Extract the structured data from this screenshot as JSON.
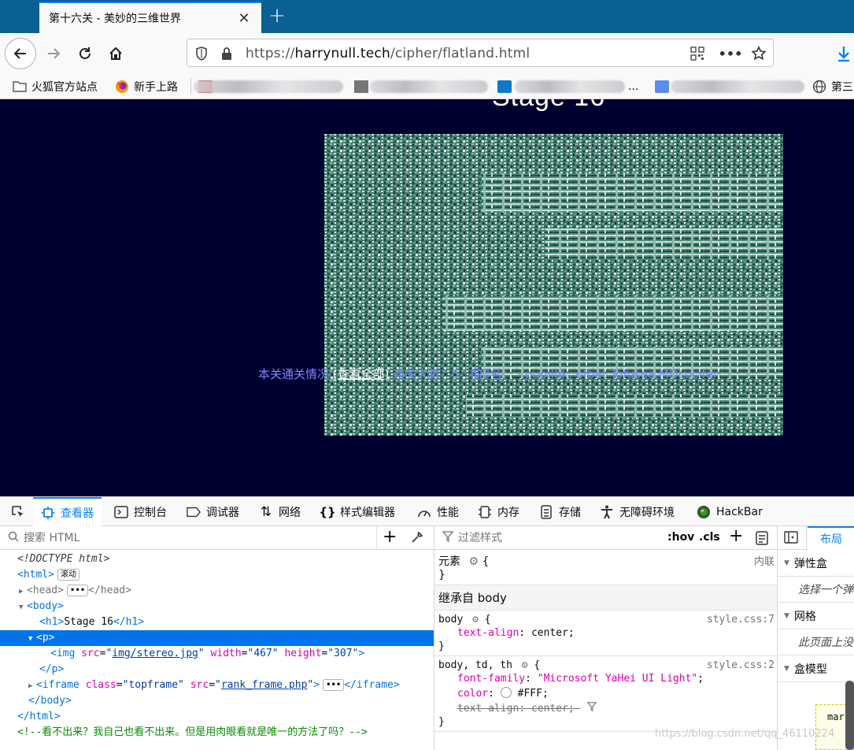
{
  "browser": {
    "tab_title": "第十六关 - 美妙的三维世界",
    "url_scheme": "https://",
    "url_host": "harrynull.tech",
    "url_path": "/cipher/flatland.html"
  },
  "bookmarks": [
    {
      "label": "火狐官方站点",
      "icon": "folder-icon"
    },
    {
      "label": "新手上路",
      "icon": "firefox-icon"
    },
    {
      "label": "...",
      "icon": "none"
    },
    {
      "label": "第三",
      "icon": "globe-icon"
    }
  ],
  "page": {
    "heading": "Stage 16",
    "rank_text_prefix": "本关通关情况 ",
    "rank_link": "(查看全部)",
    "rank_text_suffix": "   通关人数：5   ·   前3名：   ·   pupilbk,   ofbat Tofusea,MDLucifer"
  },
  "devtools": {
    "tabs": [
      {
        "label": "查看器",
        "icon": "inspector-icon",
        "active": true
      },
      {
        "label": "控制台",
        "icon": "console-icon"
      },
      {
        "label": "调试器",
        "icon": "debugger-icon"
      },
      {
        "label": "网络",
        "icon": "network-icon"
      },
      {
        "label": "样式编辑器",
        "icon": "style-editor-icon"
      },
      {
        "label": "性能",
        "icon": "performance-icon"
      },
      {
        "label": "内存",
        "icon": "memory-icon"
      },
      {
        "label": "存储",
        "icon": "storage-icon"
      },
      {
        "label": "无障碍环境",
        "icon": "accessibility-icon"
      },
      {
        "label": "HackBar",
        "icon": "hackbar-icon"
      }
    ],
    "markup": {
      "search_placeholder": "搜索 HTML",
      "doctype": "<!DOCTYPE html>",
      "html_badge": "滚动",
      "h1_text": "Stage 16",
      "img_src": "img/stereo.jpg",
      "img_width": "467",
      "img_height": "307",
      "iframe_class": "topframe",
      "iframe_src": "rank_frame.php",
      "comment": "<!--看不出来？我自己也看不出来。但是用肉眼看就是唯一的方法了吗？-->"
    },
    "rules": {
      "filter_placeholder": "过滤样式",
      "hov": ":hov",
      "cls": ".cls",
      "element_label": "元素",
      "inline_label": "内联",
      "inherited_header": "继承自 body",
      "rule1": {
        "selector": "body",
        "source": "style.css:7",
        "prop": "text-align",
        "value": "center"
      },
      "rule2": {
        "selector": "body, td, th",
        "source": "style.css:2",
        "font_prop": "font-family",
        "font_value": "\"Microsoft YaHei UI Light\"",
        "color_prop": "color",
        "color_value": "#FFF",
        "align_prop": "text-align",
        "align_value": "center"
      }
    },
    "layout": {
      "tab": "布局",
      "flex_header": "弹性盒",
      "flex_note": "选择一个弹",
      "grid_header": "网格",
      "grid_note": "此页面上没",
      "box_header": "盒模型",
      "box_margin": "mar"
    }
  },
  "watermark": "https://blog.csdn.net/qq_46110224"
}
